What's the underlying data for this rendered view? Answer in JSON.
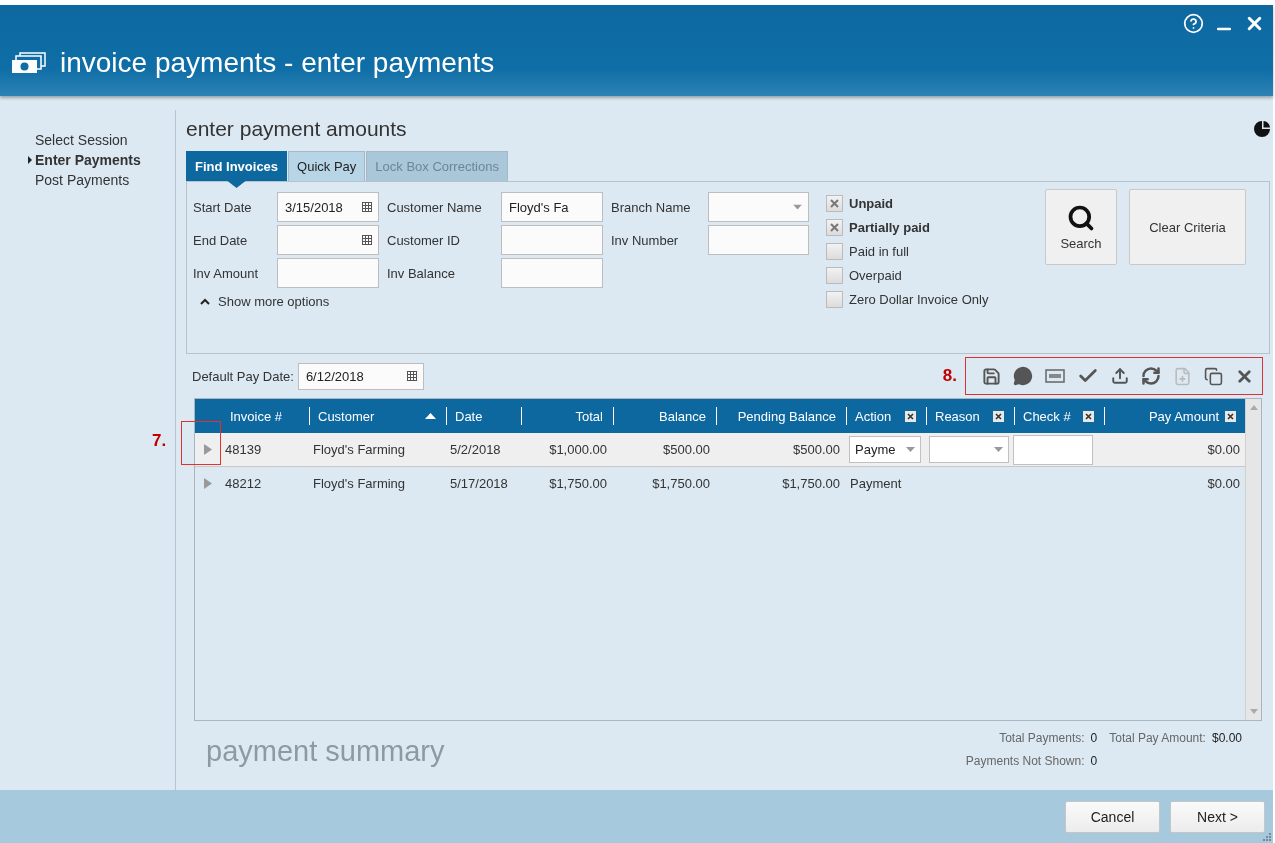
{
  "window": {
    "title": "invoice payments - enter payments"
  },
  "steps": [
    {
      "label": "Select Session",
      "selected": false
    },
    {
      "label": "Enter Payments",
      "selected": true
    },
    {
      "label": "Post Payments",
      "selected": false
    }
  ],
  "page_title": "enter payment amounts",
  "tabs": [
    {
      "label": "Find Invoices",
      "selected": true,
      "disabled": false
    },
    {
      "label": "Quick Pay",
      "selected": false,
      "disabled": false
    },
    {
      "label": "Lock Box Corrections",
      "selected": false,
      "disabled": true
    }
  ],
  "criteria": {
    "fields": [
      {
        "label": "Start Date",
        "kind": "date",
        "value": "3/15/2018"
      },
      {
        "label": "Customer Name",
        "kind": "text",
        "value": "Floyd's Fa"
      },
      {
        "label": "Branch Name",
        "kind": "select"
      },
      {
        "label": "End Date",
        "kind": "date"
      },
      {
        "label": "Customer ID",
        "kind": "text"
      },
      {
        "label": "Inv Number",
        "kind": "text"
      },
      {
        "label": "Inv Amount",
        "kind": "text"
      },
      {
        "label": "Inv Balance",
        "kind": "text"
      }
    ],
    "more_options": {
      "label": "Show more options",
      "expanded": true
    },
    "statuses": [
      {
        "label": "Unpaid",
        "checked": true
      },
      {
        "label": "Partially paid",
        "checked": true
      },
      {
        "label": "Paid in full",
        "checked": false
      },
      {
        "label": "Overpaid",
        "checked": false
      },
      {
        "label": "Zero Dollar Invoice Only",
        "checked": false
      }
    ],
    "buttons": [
      {
        "label": "Search",
        "kind": "search"
      },
      {
        "label": "Clear Criteria",
        "kind": "plain"
      }
    ]
  },
  "default_pay_date": {
    "label": "Default Pay Date:",
    "value": "6/12/2018"
  },
  "row_callout": "7.",
  "toolbar_callout": "8.",
  "table": {
    "columns": [
      {
        "label": "Invoice #",
        "removable": false,
        "sorted": false
      },
      {
        "label": "Customer",
        "removable": false,
        "sorted": true
      },
      {
        "label": "Date",
        "removable": false,
        "sorted": false
      },
      {
        "label": "Total",
        "removable": false,
        "sorted": false
      },
      {
        "label": "Balance",
        "removable": false,
        "sorted": false
      },
      {
        "label": "Pending Balance",
        "removable": false,
        "sorted": false
      },
      {
        "label": "Action",
        "removable": true,
        "sorted": false
      },
      {
        "label": "Reason",
        "removable": true,
        "sorted": false
      },
      {
        "label": "Check #",
        "removable": true,
        "sorted": false
      },
      {
        "label": "Pay Amount",
        "removable": true,
        "sorted": false
      }
    ],
    "rows": [
      {
        "selected": true,
        "cells": [
          {
            "kind": "text",
            "text": "48139"
          },
          {
            "kind": "text",
            "text": "Floyd's Farming"
          },
          {
            "kind": "text",
            "text": "5/2/2018"
          },
          {
            "kind": "text",
            "text": "$1,000.00"
          },
          {
            "kind": "text",
            "text": "$500.00"
          },
          {
            "kind": "text",
            "text": "$500.00"
          },
          {
            "kind": "select",
            "text": "Payme"
          },
          {
            "kind": "select"
          },
          {
            "kind": "input"
          },
          {
            "kind": "text",
            "text": "$0.00"
          }
        ]
      },
      {
        "selected": false,
        "cells": [
          {
            "kind": "text",
            "text": "48212"
          },
          {
            "kind": "text",
            "text": "Floyd's Farming"
          },
          {
            "kind": "text",
            "text": "5/17/2018"
          },
          {
            "kind": "text",
            "text": "$1,750.00"
          },
          {
            "kind": "text",
            "text": "$1,750.00"
          },
          {
            "kind": "text",
            "text": "$1,750.00"
          },
          {
            "kind": "text",
            "text": "Payment"
          },
          {
            "kind": "blank"
          },
          {
            "kind": "blank"
          },
          {
            "kind": "text",
            "text": "$0.00"
          }
        ]
      }
    ]
  },
  "summary": {
    "title": "payment summary",
    "totals": [
      {
        "label": "Total Payments:",
        "value": "0"
      },
      {
        "label": "Total Pay Amount:",
        "value": "$0.00"
      },
      {
        "label": "Payments Not Shown:",
        "value": "0"
      }
    ]
  },
  "footer": {
    "buttons": [
      "Cancel",
      "Next >"
    ]
  }
}
